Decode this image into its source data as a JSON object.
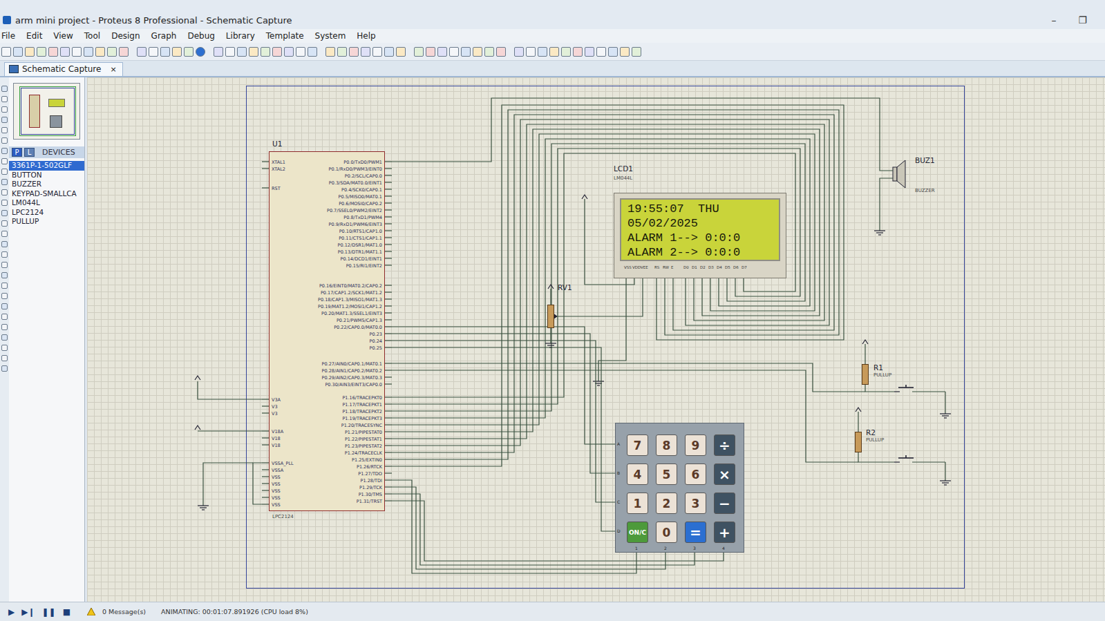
{
  "window": {
    "title": "arm mini project - Proteus 8 Professional - Schematic Capture",
    "controls": [
      "–",
      "❐"
    ]
  },
  "menu": [
    "File",
    "Edit",
    "View",
    "Tool",
    "Design",
    "Graph",
    "Debug",
    "Library",
    "Template",
    "System",
    "Help"
  ],
  "tabs": [
    {
      "label": "Schematic Capture",
      "close": "×",
      "selected": true
    }
  ],
  "devices": {
    "modes": [
      {
        "label": "P",
        "selected": true
      },
      {
        "label": "L",
        "selected": false
      }
    ],
    "title": "DEVICES",
    "items": [
      {
        "label": "3361P-1-502GLF",
        "selected": true
      },
      {
        "label": "BUTTON",
        "selected": false
      },
      {
        "label": "BUZZER",
        "selected": false
      },
      {
        "label": "KEYPAD-SMALLCA",
        "selected": false
      },
      {
        "label": "LM044L",
        "selected": false
      },
      {
        "label": "LPC2124",
        "selected": false
      },
      {
        "label": "PULLUP",
        "selected": false
      }
    ]
  },
  "schematic": {
    "u1": {
      "ref": "U1",
      "part": "LPC2124",
      "left_pin_groups": [
        [
          "XTAL1",
          "XTAL2"
        ],
        [
          "RST"
        ],
        [
          "V3A",
          "V3",
          "V3"
        ],
        [
          "V18A",
          "V18",
          "V18"
        ],
        [
          "VSSA_PLL",
          "VSSA",
          "VSS",
          "VSS",
          "VSS",
          "VSS",
          "VSS"
        ]
      ],
      "right_pin_groups": [
        [
          "P0.0/TxD0/PWM1",
          "P0.1/RxD0/PWM3/EINT0",
          "P0.2/SCL/CAP0.0",
          "P0.3/SDA/MAT0.0/EINT1",
          "P0.4/SCK0/CAP0.1",
          "P0.5/MISO0/MAT0.1",
          "P0.6/MOSI0/CAP0.2",
          "P0.7/SSEL0/PWM2/EINT2",
          "P0.8/TxD1/PWM4",
          "P0.9/RxD1/PWM6/EINT3",
          "P0.10/RTS1/CAP1.0",
          "P0.11/CTS1/CAP1.1",
          "P0.12/DSR1/MAT1.0",
          "P0.13/DTR1/MAT1.1",
          "P0.14/DCD1/EINT1",
          "P0.15/RI1/EINT2"
        ],
        [
          "P0.16/EINT0/MAT0.2/CAP0.2",
          "P0.17/CAP1.2/SCK1/MAT1.2",
          "P0.18/CAP1.3/MISO1/MAT1.3",
          "P0.19/MAT1.2/MOSI1/CAP1.2",
          "P0.20/MAT1.3/SSEL1/EINT3",
          "P0.21/PWM5/CAP1.3",
          "P0.22/CAP0.0/MAT0.0",
          "P0.23",
          "P0.24",
          "P0.25"
        ],
        [
          "P0.27/AIN0/CAP0.1/MAT0.1",
          "P0.28/AIN1/CAP0.2/MAT0.2",
          "P0.29/AIN2/CAP0.3/MAT0.3",
          "P0.30/AIN3/EINT3/CAP0.0"
        ],
        [
          "P1.16/TRACEPKT0",
          "P1.17/TRACEPKT1",
          "P1.18/TRACEPKT2",
          "P1.19/TRACEPKT3",
          "P1.20/TRACESYNC",
          "P1.21/PIPESTAT0",
          "P1.22/PIPESTAT1",
          "P1.23/PIPESTAT2",
          "P1.24/TRACECLK",
          "P1.25/EXTIN0",
          "P1.26/RTCK",
          "P1.27/TDO",
          "P1.28/TDI",
          "P1.29/TCK",
          "P1.30/TMS",
          "P1.31/TRST"
        ]
      ]
    },
    "lcd": {
      "ref": "LCD1",
      "part": "LM044L",
      "lines": [
        "19:55:07  THU",
        "05/02/2025",
        "ALARM 1--> 0:0:0",
        "ALARM 2--> 0:0:0"
      ],
      "pins": [
        "VSS",
        "VDD",
        "VEE",
        "RS",
        "RW",
        "E",
        "D0",
        "D1",
        "D2",
        "D3",
        "D4",
        "D5",
        "D6",
        "D7"
      ]
    },
    "rv1": {
      "ref": "RV1"
    },
    "buzzer": {
      "ref": "BUZ1",
      "part": "BUZZER"
    },
    "resistors": [
      {
        "ref": "R1",
        "part": "PULLUP"
      },
      {
        "ref": "R2",
        "part": "PULLUP"
      }
    ],
    "keypad": {
      "row_labels": [
        "A",
        "B",
        "C",
        "D"
      ],
      "col_labels": [
        "1",
        "2",
        "3",
        "4"
      ],
      "keys": [
        [
          {
            "label": "7",
            "kind": "digit"
          },
          {
            "label": "8",
            "kind": "digit"
          },
          {
            "label": "9",
            "kind": "digit"
          },
          {
            "label": "÷",
            "kind": "op"
          }
        ],
        [
          {
            "label": "4",
            "kind": "digit"
          },
          {
            "label": "5",
            "kind": "digit"
          },
          {
            "label": "6",
            "kind": "digit"
          },
          {
            "label": "×",
            "kind": "op"
          }
        ],
        [
          {
            "label": "1",
            "kind": "digit"
          },
          {
            "label": "2",
            "kind": "digit"
          },
          {
            "label": "3",
            "kind": "digit"
          },
          {
            "label": "−",
            "kind": "op"
          }
        ],
        [
          {
            "label": "ON/C",
            "kind": "clear"
          },
          {
            "label": "0",
            "kind": "digit"
          },
          {
            "label": "=",
            "kind": "equals"
          },
          {
            "label": "+",
            "kind": "op"
          }
        ]
      ]
    }
  },
  "status_bar": {
    "controls": [
      "▶",
      "▶❙",
      "❚❚",
      "■"
    ],
    "messages": "0 Message(s)",
    "animation": "ANIMATING: 00:01:07.891926 (CPU load 8%)"
  }
}
